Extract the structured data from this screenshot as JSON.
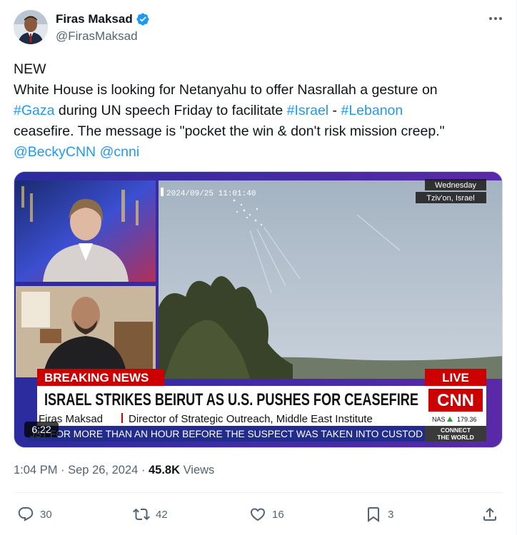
{
  "author": {
    "name": "Firas Maksad",
    "handle": "@FirasMaksad"
  },
  "tweet": {
    "line1": "NEW",
    "line2": "White House is looking for Netanyahu to offer Nasrallah a gesture on",
    "hashtag_gaza": "#Gaza",
    "line3_mid": " during UN speech Friday to facilitate ",
    "hashtag_israel": "#Israel",
    "line3_dash": " - ",
    "hashtag_lebanon": "#Lebanon",
    "line4": "ceasefire. The message is \"pocket the win & don't risk mission creep.\"",
    "mention_becky": "@BeckyCNN",
    "mention_cnni": "@cnni"
  },
  "video": {
    "duration": "6:22",
    "timestamp_overlay": "2024/09/25  11:01:40",
    "location_day": "Wednesday",
    "location_place": "Tziv'on, Israel",
    "breaking_label": "BREAKING NEWS",
    "live_label": "LIVE",
    "headline": "ISRAEL STRIKES BEIRUT AS U.S. PUSHES FOR CEASEFIRE",
    "guest_name": "Firas Maksad",
    "guest_title": "Director of Strategic Outreach, Middle East Institute",
    "network_logo": "CNN",
    "ticker_market": "NAS",
    "ticker_value": "179.36",
    "ticker_text": "JST FOR MORE THAN AN HOUR BEFORE THE SUSPECT WAS TAKEN INTO CUSTOD",
    "connect_line1": "CONNECT",
    "connect_line2": "THE WORLD"
  },
  "meta": {
    "time": "1:04 PM",
    "separator": " · ",
    "date": "Sep 26, 2024",
    "views_count": "45.8K",
    "views_label": " Views"
  },
  "actions": {
    "replies": "30",
    "reposts": "42",
    "likes": "16",
    "bookmarks": "3"
  },
  "colors": {
    "link": "#1d9bf0",
    "cnn_red": "#cc0000",
    "secondary_text": "#536471"
  }
}
